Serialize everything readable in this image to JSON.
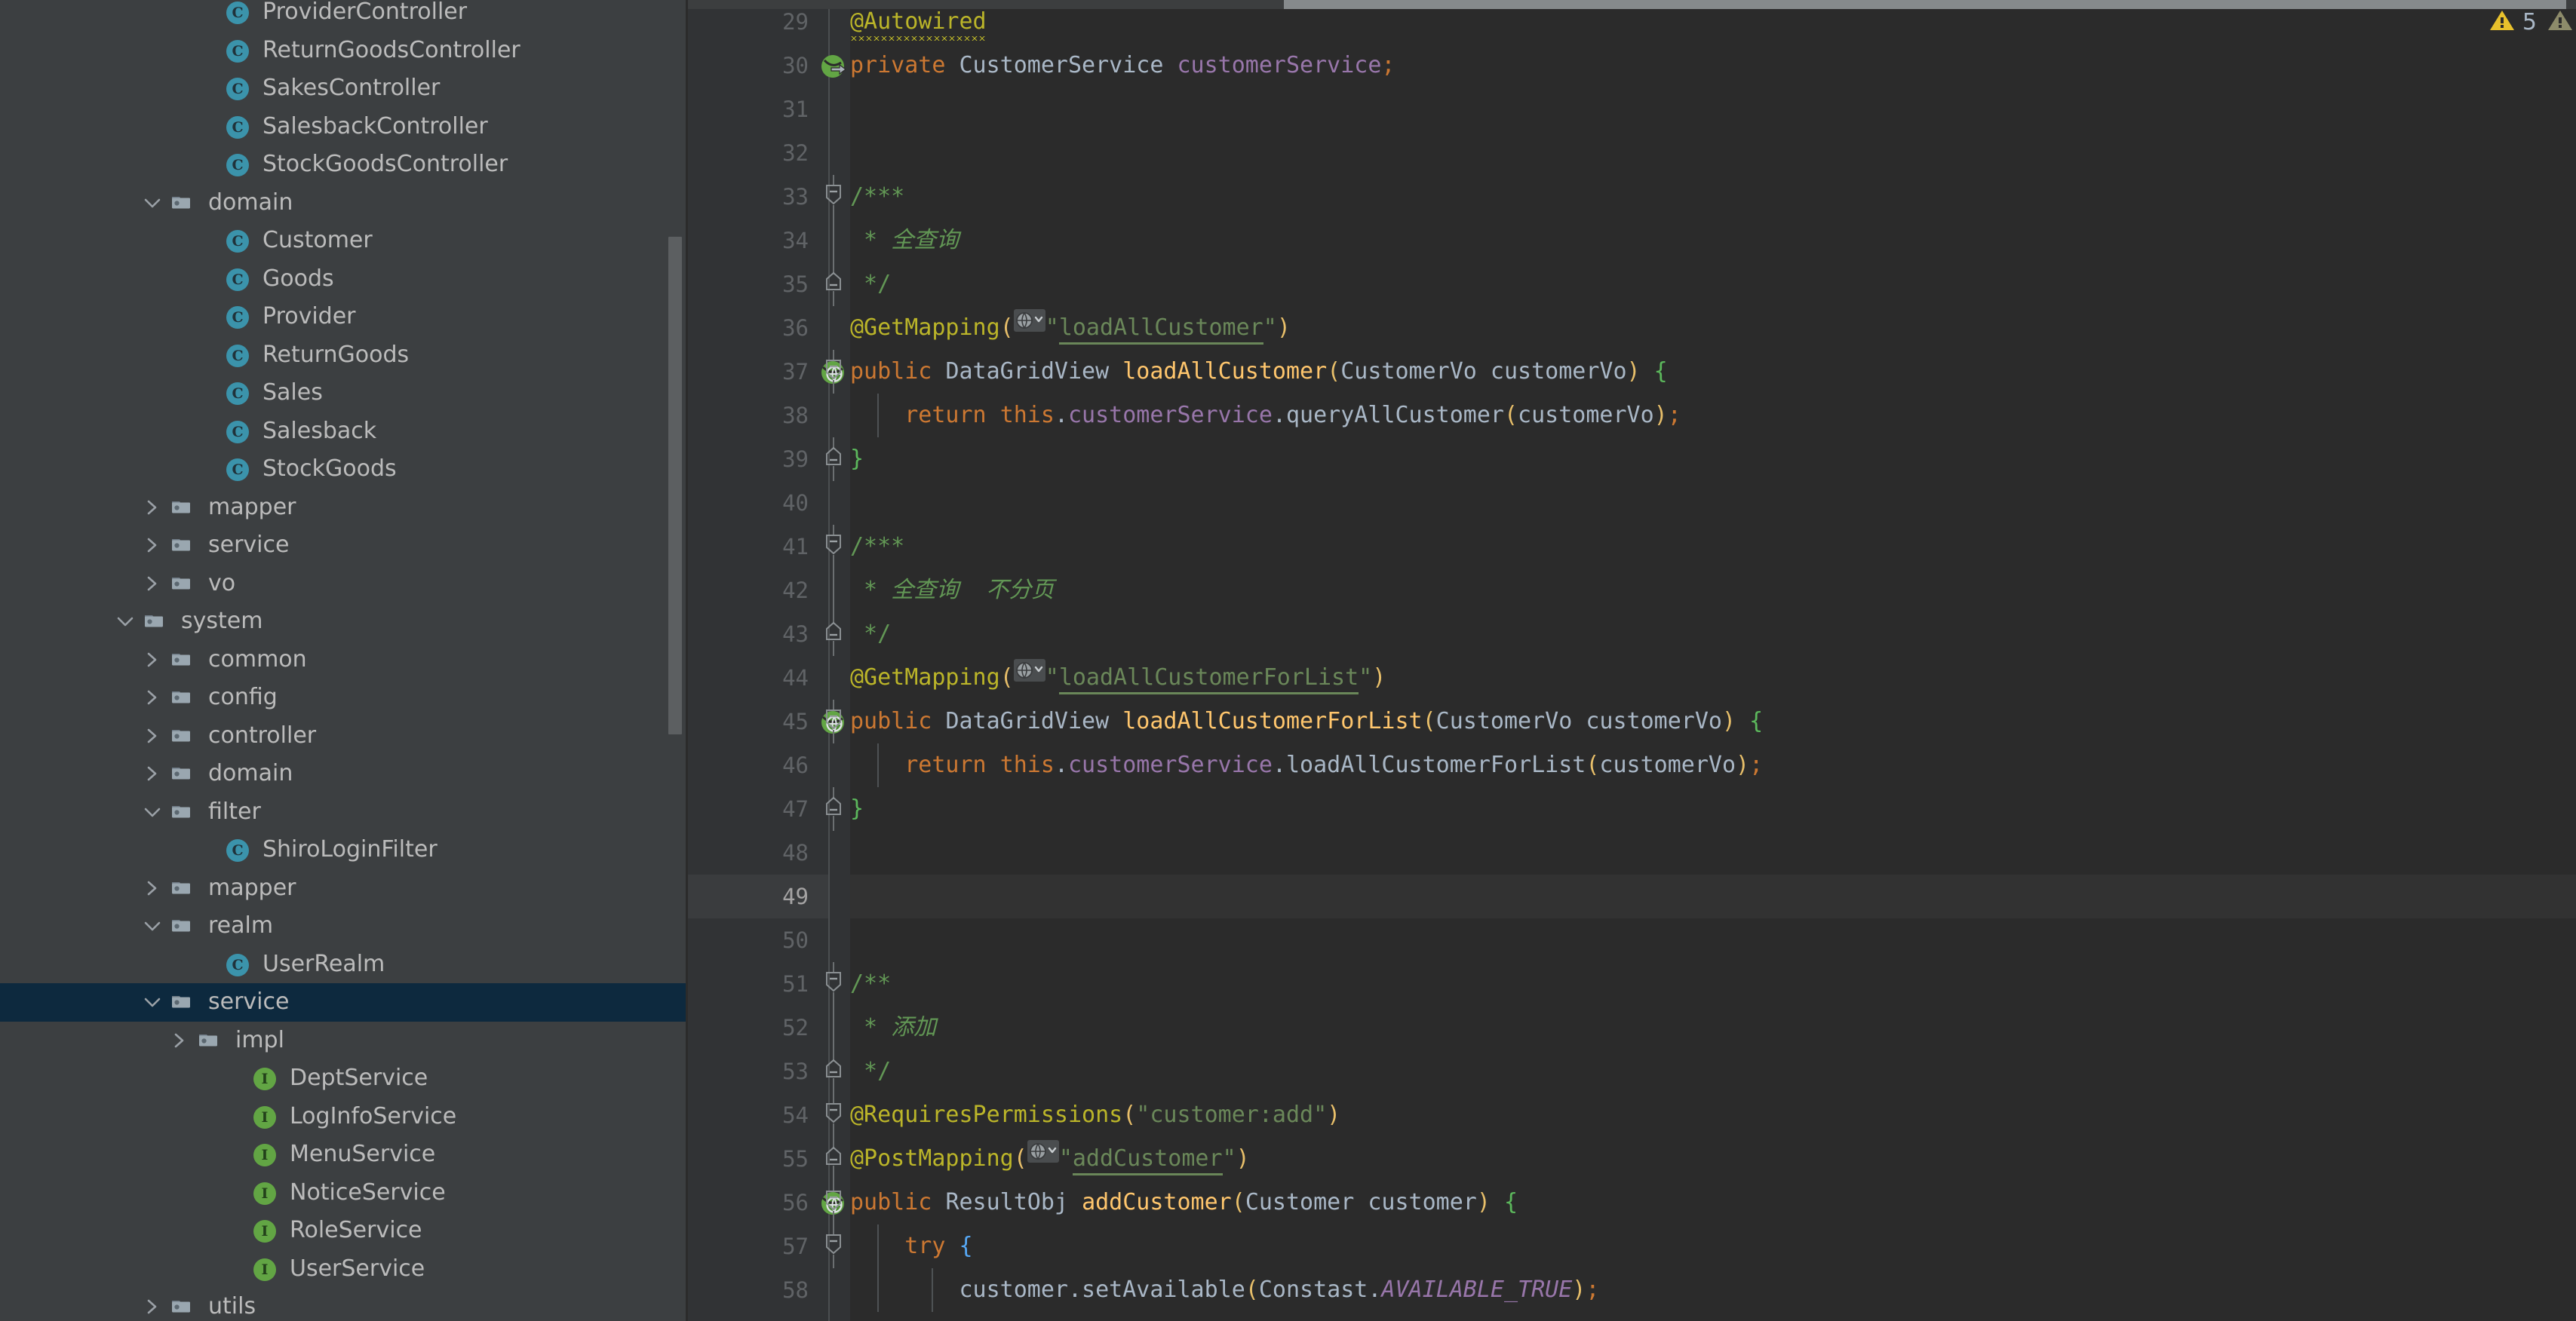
{
  "sidebar": {
    "scrollbar": "vertical-scrollbar",
    "tree": [
      {
        "label": "ProviderController",
        "icon": "class-icon",
        "indent": 7,
        "arrow": "none"
      },
      {
        "label": "ReturnGoodsController",
        "icon": "class-icon",
        "indent": 7,
        "arrow": "none"
      },
      {
        "label": "SakesController",
        "icon": "class-icon",
        "indent": 7,
        "arrow": "none"
      },
      {
        "label": "SalesbackController",
        "icon": "class-icon",
        "indent": 7,
        "arrow": "none"
      },
      {
        "label": "StockGoodsController",
        "icon": "class-icon",
        "indent": 7,
        "arrow": "none"
      },
      {
        "label": "domain",
        "icon": "folder-icon",
        "indent": 5,
        "arrow": "down"
      },
      {
        "label": "Customer",
        "icon": "class-icon",
        "indent": 7,
        "arrow": "none"
      },
      {
        "label": "Goods",
        "icon": "class-icon",
        "indent": 7,
        "arrow": "none"
      },
      {
        "label": "Provider",
        "icon": "class-icon",
        "indent": 7,
        "arrow": "none"
      },
      {
        "label": "ReturnGoods",
        "icon": "class-icon",
        "indent": 7,
        "arrow": "none"
      },
      {
        "label": "Sales",
        "icon": "class-icon",
        "indent": 7,
        "arrow": "none"
      },
      {
        "label": "Salesback",
        "icon": "class-icon",
        "indent": 7,
        "arrow": "none"
      },
      {
        "label": "StockGoods",
        "icon": "class-icon",
        "indent": 7,
        "arrow": "none"
      },
      {
        "label": "mapper",
        "icon": "folder-icon",
        "indent": 5,
        "arrow": "right"
      },
      {
        "label": "service",
        "icon": "folder-icon",
        "indent": 5,
        "arrow": "right"
      },
      {
        "label": "vo",
        "icon": "folder-icon",
        "indent": 5,
        "arrow": "right"
      },
      {
        "label": "system",
        "icon": "folder-icon",
        "indent": 4,
        "arrow": "down"
      },
      {
        "label": "common",
        "icon": "folder-icon",
        "indent": 5,
        "arrow": "right"
      },
      {
        "label": "config",
        "icon": "folder-icon",
        "indent": 5,
        "arrow": "right"
      },
      {
        "label": "controller",
        "icon": "folder-icon",
        "indent": 5,
        "arrow": "right"
      },
      {
        "label": "domain",
        "icon": "folder-icon",
        "indent": 5,
        "arrow": "right"
      },
      {
        "label": "filter",
        "icon": "folder-icon",
        "indent": 5,
        "arrow": "down"
      },
      {
        "label": "ShiroLoginFilter",
        "icon": "class-icon",
        "indent": 7,
        "arrow": "none"
      },
      {
        "label": "mapper",
        "icon": "folder-icon",
        "indent": 5,
        "arrow": "right"
      },
      {
        "label": "realm",
        "icon": "folder-icon",
        "indent": 5,
        "arrow": "down"
      },
      {
        "label": "UserRealm",
        "icon": "class-icon",
        "indent": 7,
        "arrow": "none"
      },
      {
        "label": "service",
        "icon": "folder-icon",
        "indent": 5,
        "arrow": "down",
        "selected": true
      },
      {
        "label": "impl",
        "icon": "folder-icon",
        "indent": 6,
        "arrow": "right"
      },
      {
        "label": "DeptService",
        "icon": "interface-icon",
        "indent": 8,
        "arrow": "none"
      },
      {
        "label": "LogInfoService",
        "icon": "interface-icon",
        "indent": 8,
        "arrow": "none"
      },
      {
        "label": "MenuService",
        "icon": "interface-icon",
        "indent": 8,
        "arrow": "none"
      },
      {
        "label": "NoticeService",
        "icon": "interface-icon",
        "indent": 8,
        "arrow": "none"
      },
      {
        "label": "RoleService",
        "icon": "interface-icon",
        "indent": 8,
        "arrow": "none"
      },
      {
        "label": "UserService",
        "icon": "interface-icon",
        "indent": 8,
        "arrow": "none"
      },
      {
        "label": "utils",
        "icon": "folder-icon",
        "indent": 5,
        "arrow": "right"
      }
    ]
  },
  "editor": {
    "warnings": [
      {
        "icon": "warning-triangle-icon",
        "count": "5",
        "color": "#e8c12c"
      },
      {
        "icon": "warning-triangle-icon",
        "count": "",
        "color": "#8d8b6a"
      }
    ],
    "current_line": 49,
    "first_line": 29,
    "lines": [
      {
        "n": 29,
        "gutter": "",
        "fold": "",
        "indent": 0,
        "tokens": [
          {
            "t": "@Autowired",
            "c": "ann squig"
          }
        ]
      },
      {
        "n": 30,
        "gutter": "spring-bean-icon",
        "fold": "",
        "indent": 0,
        "tokens": [
          {
            "t": "private ",
            "c": "kw"
          },
          {
            "t": "CustomerService ",
            "c": "type"
          },
          {
            "t": "customerService",
            "c": "field"
          },
          {
            "t": ";",
            "c": "semi"
          }
        ]
      },
      {
        "n": 31,
        "gutter": "",
        "fold": "",
        "indent": 0,
        "tokens": []
      },
      {
        "n": 32,
        "gutter": "",
        "fold": "",
        "indent": 0,
        "tokens": []
      },
      {
        "n": 33,
        "gutter": "",
        "fold": "fold-start",
        "indent": 0,
        "tokens": [
          {
            "t": "/***",
            "c": "cmt"
          }
        ]
      },
      {
        "n": 34,
        "gutter": "",
        "fold": "fold-line",
        "indent": 0,
        "tokens": [
          {
            "t": " * ",
            "c": "cmt"
          },
          {
            "t": "全查询",
            "c": "cmtit"
          }
        ]
      },
      {
        "n": 35,
        "gutter": "",
        "fold": "fold-end",
        "indent": 0,
        "tokens": [
          {
            "t": " */",
            "c": "cmt"
          }
        ]
      },
      {
        "n": 36,
        "gutter": "",
        "fold": "",
        "indent": 0,
        "tokens": [
          {
            "t": "@GetMapping",
            "c": "ann"
          },
          {
            "t": "(",
            "c": "paren"
          },
          {
            "t": "GLOBE",
            "c": "globe"
          },
          {
            "t": "\"",
            "c": "str"
          },
          {
            "t": "loadAllCustomer",
            "c": "ustr"
          },
          {
            "t": "\"",
            "c": "str"
          },
          {
            "t": ")",
            "c": "paren"
          }
        ]
      },
      {
        "n": 37,
        "gutter": "spring-mapping-icon",
        "fold": "fold-start",
        "indent": 0,
        "tokens": [
          {
            "t": "public ",
            "c": "kw"
          },
          {
            "t": "DataGridView ",
            "c": "type"
          },
          {
            "t": "loadAllCustomer",
            "c": "mname"
          },
          {
            "t": "(",
            "c": "paren"
          },
          {
            "t": "CustomerVo customerVo",
            "c": "type"
          },
          {
            "t": ")",
            "c": "paren"
          },
          {
            "t": " ",
            "c": "plain"
          },
          {
            "t": "{",
            "c": "brace2"
          }
        ]
      },
      {
        "n": 38,
        "gutter": "",
        "fold": "",
        "indent": 1,
        "tokens": [
          {
            "t": "    return ",
            "c": "kw"
          },
          {
            "t": "this",
            "c": "kw"
          },
          {
            "t": ".",
            "c": "plain"
          },
          {
            "t": "customerService",
            "c": "field"
          },
          {
            "t": ".",
            "c": "plain"
          },
          {
            "t": "queryAllCustomer",
            "c": "type"
          },
          {
            "t": "(",
            "c": "paren"
          },
          {
            "t": "customerVo",
            "c": "type"
          },
          {
            "t": ")",
            "c": "paren"
          },
          {
            "t": ";",
            "c": "semi"
          }
        ]
      },
      {
        "n": 39,
        "gutter": "",
        "fold": "fold-end",
        "indent": 0,
        "tokens": [
          {
            "t": "}",
            "c": "brace2"
          }
        ]
      },
      {
        "n": 40,
        "gutter": "",
        "fold": "",
        "indent": 0,
        "tokens": []
      },
      {
        "n": 41,
        "gutter": "",
        "fold": "fold-start",
        "indent": 0,
        "tokens": [
          {
            "t": "/***",
            "c": "cmt"
          }
        ]
      },
      {
        "n": 42,
        "gutter": "",
        "fold": "fold-line",
        "indent": 0,
        "tokens": [
          {
            "t": " * ",
            "c": "cmt"
          },
          {
            "t": "全查询  不分页",
            "c": "cmtit"
          }
        ]
      },
      {
        "n": 43,
        "gutter": "",
        "fold": "fold-end",
        "indent": 0,
        "tokens": [
          {
            "t": " */",
            "c": "cmt"
          }
        ]
      },
      {
        "n": 44,
        "gutter": "",
        "fold": "",
        "indent": 0,
        "tokens": [
          {
            "t": "@GetMapping",
            "c": "ann"
          },
          {
            "t": "(",
            "c": "paren"
          },
          {
            "t": "GLOBE",
            "c": "globe"
          },
          {
            "t": "\"",
            "c": "str"
          },
          {
            "t": "loadAllCustomerForList",
            "c": "ustr"
          },
          {
            "t": "\"",
            "c": "str"
          },
          {
            "t": ")",
            "c": "paren"
          }
        ]
      },
      {
        "n": 45,
        "gutter": "spring-mapping-icon",
        "fold": "fold-start",
        "indent": 0,
        "tokens": [
          {
            "t": "public ",
            "c": "kw"
          },
          {
            "t": "DataGridView ",
            "c": "type"
          },
          {
            "t": "loadAllCustomerForList",
            "c": "mname"
          },
          {
            "t": "(",
            "c": "paren"
          },
          {
            "t": "CustomerVo customerVo",
            "c": "type"
          },
          {
            "t": ")",
            "c": "paren"
          },
          {
            "t": " ",
            "c": "plain"
          },
          {
            "t": "{",
            "c": "brace2"
          }
        ]
      },
      {
        "n": 46,
        "gutter": "",
        "fold": "",
        "indent": 1,
        "tokens": [
          {
            "t": "    return ",
            "c": "kw"
          },
          {
            "t": "this",
            "c": "kw"
          },
          {
            "t": ".",
            "c": "plain"
          },
          {
            "t": "customerService",
            "c": "field"
          },
          {
            "t": ".",
            "c": "plain"
          },
          {
            "t": "loadAllCustomerForList",
            "c": "type"
          },
          {
            "t": "(",
            "c": "paren"
          },
          {
            "t": "customerVo",
            "c": "type"
          },
          {
            "t": ")",
            "c": "paren"
          },
          {
            "t": ";",
            "c": "semi"
          }
        ]
      },
      {
        "n": 47,
        "gutter": "",
        "fold": "fold-end",
        "indent": 0,
        "tokens": [
          {
            "t": "}",
            "c": "brace2"
          }
        ]
      },
      {
        "n": 48,
        "gutter": "",
        "fold": "",
        "indent": 0,
        "tokens": []
      },
      {
        "n": 49,
        "gutter": "",
        "fold": "",
        "indent": 0,
        "current": true,
        "tokens": []
      },
      {
        "n": 50,
        "gutter": "",
        "fold": "",
        "indent": 0,
        "tokens": []
      },
      {
        "n": 51,
        "gutter": "",
        "fold": "fold-start",
        "indent": 0,
        "tokens": [
          {
            "t": "/**",
            "c": "cmt"
          }
        ]
      },
      {
        "n": 52,
        "gutter": "",
        "fold": "fold-line",
        "indent": 0,
        "tokens": [
          {
            "t": " * ",
            "c": "cmt"
          },
          {
            "t": "添加",
            "c": "cmtit"
          }
        ]
      },
      {
        "n": 53,
        "gutter": "",
        "fold": "fold-end",
        "indent": 0,
        "tokens": [
          {
            "t": " */",
            "c": "cmt"
          }
        ]
      },
      {
        "n": 54,
        "gutter": "",
        "fold": "fold-start",
        "indent": 0,
        "tokens": [
          {
            "t": "@RequiresPermissions",
            "c": "ann"
          },
          {
            "t": "(",
            "c": "paren"
          },
          {
            "t": "\"customer:add\"",
            "c": "str"
          },
          {
            "t": ")",
            "c": "paren"
          }
        ]
      },
      {
        "n": 55,
        "gutter": "",
        "fold": "fold-end",
        "indent": 0,
        "tokens": [
          {
            "t": "@PostMapping",
            "c": "ann"
          },
          {
            "t": "(",
            "c": "paren"
          },
          {
            "t": "GLOBE",
            "c": "globe"
          },
          {
            "t": "\"",
            "c": "str"
          },
          {
            "t": "addCustomer",
            "c": "ustr"
          },
          {
            "t": "\"",
            "c": "str"
          },
          {
            "t": ")",
            "c": "paren"
          }
        ]
      },
      {
        "n": 56,
        "gutter": "spring-mapping-icon",
        "fold": "fold-start",
        "indent": 0,
        "tokens": [
          {
            "t": "public ",
            "c": "kw"
          },
          {
            "t": "ResultObj ",
            "c": "type"
          },
          {
            "t": "addCustomer",
            "c": "mname"
          },
          {
            "t": "(",
            "c": "paren"
          },
          {
            "t": "Customer customer",
            "c": "type"
          },
          {
            "t": ")",
            "c": "paren"
          },
          {
            "t": " ",
            "c": "plain"
          },
          {
            "t": "{",
            "c": "brace2"
          }
        ]
      },
      {
        "n": 57,
        "gutter": "",
        "fold": "fold-start",
        "indent": 1,
        "tokens": [
          {
            "t": "    try ",
            "c": "kw"
          },
          {
            "t": "{",
            "c": "brace3"
          }
        ]
      },
      {
        "n": 58,
        "gutter": "",
        "fold": "",
        "indent": 2,
        "tokens": [
          {
            "t": "        customer",
            "c": "plain"
          },
          {
            "t": ".",
            "c": "plain"
          },
          {
            "t": "setAvailable",
            "c": "type"
          },
          {
            "t": "(",
            "c": "paren"
          },
          {
            "t": "Constast",
            "c": "type"
          },
          {
            "t": ".",
            "c": "plain"
          },
          {
            "t": "AVAILABLE_TRUE",
            "c": "constit"
          },
          {
            "t": ")",
            "c": "paren"
          },
          {
            "t": ";",
            "c": "semi"
          }
        ]
      }
    ]
  }
}
